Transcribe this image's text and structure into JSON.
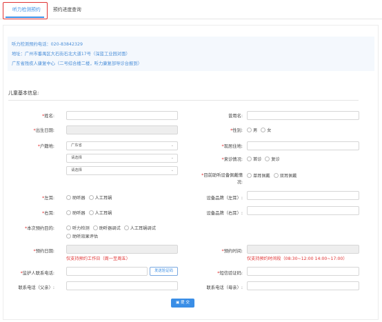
{
  "tabs": [
    {
      "label": "听力检测预约"
    },
    {
      "label": "预约进度查询"
    }
  ],
  "notice": {
    "phone": "听力检测预约电话：020-83842329",
    "address": "地址：广州市番禺区大石街石北大道17号（深蓝工业园对面）",
    "center": "广东省残疾人康复中心（二号综合楼二楼，听力康复部导诊台报到）"
  },
  "section_title": "儿童基本信息:",
  "labels": {
    "name": "姓名:",
    "former_name": "曾用名:",
    "birth_date": "出生日期:",
    "gender": "性别:",
    "hukou": "户籍地:",
    "residence": "现居住地:",
    "visit_type": "来诊情况:",
    "device_wearing": "目前助听设备佩戴情",
    "device_wearing_2": "况:",
    "left_ear": "左耳:",
    "left_brand": "设备品牌（左耳）:",
    "right_ear": "右耳:",
    "right_brand": "设备品牌（右耳）:",
    "purpose": "本次预约目的:",
    "appt_date": "预约日期:",
    "appt_time": "预约时间:",
    "guardian_phone": "监护人联系电话:",
    "sms_code": "短信验证码:",
    "father_phone": "联系电话（父亲）:",
    "mother_phone": "联系电话（母亲）:"
  },
  "selects": {
    "province": "广东省",
    "city": "请选择",
    "district": "请选择"
  },
  "options": {
    "gender": [
      "男",
      "女"
    ],
    "visit": [
      "首诊",
      "复诊"
    ],
    "wearing": [
      "单耳佩戴",
      "双耳佩戴"
    ],
    "ear_device": [
      "助听器",
      "人工耳蜗"
    ],
    "purpose_row1": [
      "听力检测",
      "助听器调试",
      "人工耳蜗调试"
    ],
    "purpose_row2": [
      "助听效果评估"
    ]
  },
  "hints": {
    "date": "仅支持预约工作日（周一至周五）",
    "time": "仅支持预约时间段（08:30~12:00 14:00~17:00）"
  },
  "buttons": {
    "send_code": "发送验证码",
    "submit": "提 交",
    "submit_icon": "▣"
  }
}
